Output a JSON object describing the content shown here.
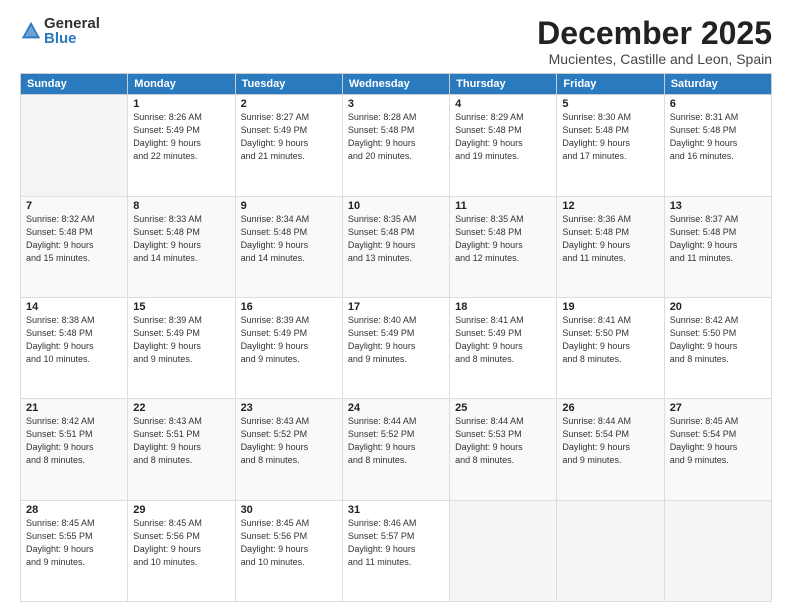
{
  "logo": {
    "general": "General",
    "blue": "Blue"
  },
  "title": "December 2025",
  "location": "Mucientes, Castille and Leon, Spain",
  "weekdays": [
    "Sunday",
    "Monday",
    "Tuesday",
    "Wednesday",
    "Thursday",
    "Friday",
    "Saturday"
  ],
  "weeks": [
    [
      {
        "day": "",
        "info": ""
      },
      {
        "day": "1",
        "info": "Sunrise: 8:26 AM\nSunset: 5:49 PM\nDaylight: 9 hours\nand 22 minutes."
      },
      {
        "day": "2",
        "info": "Sunrise: 8:27 AM\nSunset: 5:49 PM\nDaylight: 9 hours\nand 21 minutes."
      },
      {
        "day": "3",
        "info": "Sunrise: 8:28 AM\nSunset: 5:48 PM\nDaylight: 9 hours\nand 20 minutes."
      },
      {
        "day": "4",
        "info": "Sunrise: 8:29 AM\nSunset: 5:48 PM\nDaylight: 9 hours\nand 19 minutes."
      },
      {
        "day": "5",
        "info": "Sunrise: 8:30 AM\nSunset: 5:48 PM\nDaylight: 9 hours\nand 17 minutes."
      },
      {
        "day": "6",
        "info": "Sunrise: 8:31 AM\nSunset: 5:48 PM\nDaylight: 9 hours\nand 16 minutes."
      }
    ],
    [
      {
        "day": "7",
        "info": "Sunrise: 8:32 AM\nSunset: 5:48 PM\nDaylight: 9 hours\nand 15 minutes."
      },
      {
        "day": "8",
        "info": "Sunrise: 8:33 AM\nSunset: 5:48 PM\nDaylight: 9 hours\nand 14 minutes."
      },
      {
        "day": "9",
        "info": "Sunrise: 8:34 AM\nSunset: 5:48 PM\nDaylight: 9 hours\nand 14 minutes."
      },
      {
        "day": "10",
        "info": "Sunrise: 8:35 AM\nSunset: 5:48 PM\nDaylight: 9 hours\nand 13 minutes."
      },
      {
        "day": "11",
        "info": "Sunrise: 8:35 AM\nSunset: 5:48 PM\nDaylight: 9 hours\nand 12 minutes."
      },
      {
        "day": "12",
        "info": "Sunrise: 8:36 AM\nSunset: 5:48 PM\nDaylight: 9 hours\nand 11 minutes."
      },
      {
        "day": "13",
        "info": "Sunrise: 8:37 AM\nSunset: 5:48 PM\nDaylight: 9 hours\nand 11 minutes."
      }
    ],
    [
      {
        "day": "14",
        "info": "Sunrise: 8:38 AM\nSunset: 5:48 PM\nDaylight: 9 hours\nand 10 minutes."
      },
      {
        "day": "15",
        "info": "Sunrise: 8:39 AM\nSunset: 5:49 PM\nDaylight: 9 hours\nand 9 minutes."
      },
      {
        "day": "16",
        "info": "Sunrise: 8:39 AM\nSunset: 5:49 PM\nDaylight: 9 hours\nand 9 minutes."
      },
      {
        "day": "17",
        "info": "Sunrise: 8:40 AM\nSunset: 5:49 PM\nDaylight: 9 hours\nand 9 minutes."
      },
      {
        "day": "18",
        "info": "Sunrise: 8:41 AM\nSunset: 5:49 PM\nDaylight: 9 hours\nand 8 minutes."
      },
      {
        "day": "19",
        "info": "Sunrise: 8:41 AM\nSunset: 5:50 PM\nDaylight: 9 hours\nand 8 minutes."
      },
      {
        "day": "20",
        "info": "Sunrise: 8:42 AM\nSunset: 5:50 PM\nDaylight: 9 hours\nand 8 minutes."
      }
    ],
    [
      {
        "day": "21",
        "info": "Sunrise: 8:42 AM\nSunset: 5:51 PM\nDaylight: 9 hours\nand 8 minutes."
      },
      {
        "day": "22",
        "info": "Sunrise: 8:43 AM\nSunset: 5:51 PM\nDaylight: 9 hours\nand 8 minutes."
      },
      {
        "day": "23",
        "info": "Sunrise: 8:43 AM\nSunset: 5:52 PM\nDaylight: 9 hours\nand 8 minutes."
      },
      {
        "day": "24",
        "info": "Sunrise: 8:44 AM\nSunset: 5:52 PM\nDaylight: 9 hours\nand 8 minutes."
      },
      {
        "day": "25",
        "info": "Sunrise: 8:44 AM\nSunset: 5:53 PM\nDaylight: 9 hours\nand 8 minutes."
      },
      {
        "day": "26",
        "info": "Sunrise: 8:44 AM\nSunset: 5:54 PM\nDaylight: 9 hours\nand 9 minutes."
      },
      {
        "day": "27",
        "info": "Sunrise: 8:45 AM\nSunset: 5:54 PM\nDaylight: 9 hours\nand 9 minutes."
      }
    ],
    [
      {
        "day": "28",
        "info": "Sunrise: 8:45 AM\nSunset: 5:55 PM\nDaylight: 9 hours\nand 9 minutes."
      },
      {
        "day": "29",
        "info": "Sunrise: 8:45 AM\nSunset: 5:56 PM\nDaylight: 9 hours\nand 10 minutes."
      },
      {
        "day": "30",
        "info": "Sunrise: 8:45 AM\nSunset: 5:56 PM\nDaylight: 9 hours\nand 10 minutes."
      },
      {
        "day": "31",
        "info": "Sunrise: 8:46 AM\nSunset: 5:57 PM\nDaylight: 9 hours\nand 11 minutes."
      },
      {
        "day": "",
        "info": ""
      },
      {
        "day": "",
        "info": ""
      },
      {
        "day": "",
        "info": ""
      }
    ]
  ]
}
